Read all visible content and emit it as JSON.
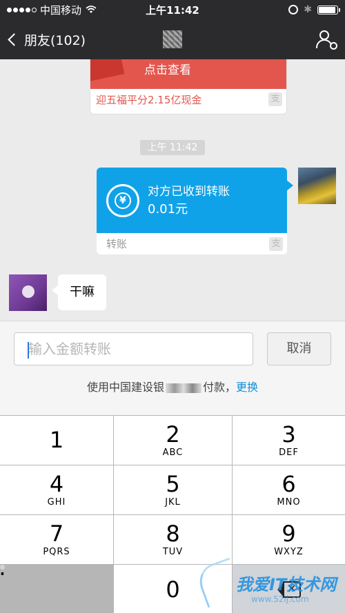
{
  "status_bar": {
    "carrier": "中国移动",
    "time": "上午11:42"
  },
  "nav": {
    "back_label": "朋友(102)"
  },
  "chat": {
    "red_card": {
      "action": "点击查看",
      "promo": "迎五福平分2.15亿现金",
      "brand_mark": "支"
    },
    "timestamp": "上午 11:42",
    "transfer_card": {
      "title": "对方已收到转账",
      "amount": "0.01元",
      "footer": "转账",
      "icon_glyph": "¥",
      "brand_mark": "支"
    },
    "incoming_message": "干嘛"
  },
  "input_panel": {
    "placeholder": "输入金额转账",
    "cancel_label": "取消",
    "pay_prefix": "使用中国建设银",
    "pay_suffix": "付款，",
    "change_label": "更换"
  },
  "keypad": {
    "keys": [
      {
        "num": "1",
        "letters": ""
      },
      {
        "num": "2",
        "letters": "ABC"
      },
      {
        "num": "3",
        "letters": "DEF"
      },
      {
        "num": "4",
        "letters": "GHI"
      },
      {
        "num": "5",
        "letters": "JKL"
      },
      {
        "num": "6",
        "letters": "MNO"
      },
      {
        "num": "7",
        "letters": "PQRS"
      },
      {
        "num": "8",
        "letters": "TUV"
      },
      {
        "num": "9",
        "letters": "WXYZ"
      },
      {
        "num": ".",
        "letters": ""
      },
      {
        "num": "0",
        "letters": ""
      }
    ]
  },
  "watermark": {
    "brand": "我爱IT技术网",
    "site": "www.52ij.com"
  },
  "colors": {
    "nav_bg": "#2b2b2d",
    "transfer_blue": "#10a2e8",
    "red_card": "#e2564e",
    "link_blue": "#0a8fe0"
  }
}
